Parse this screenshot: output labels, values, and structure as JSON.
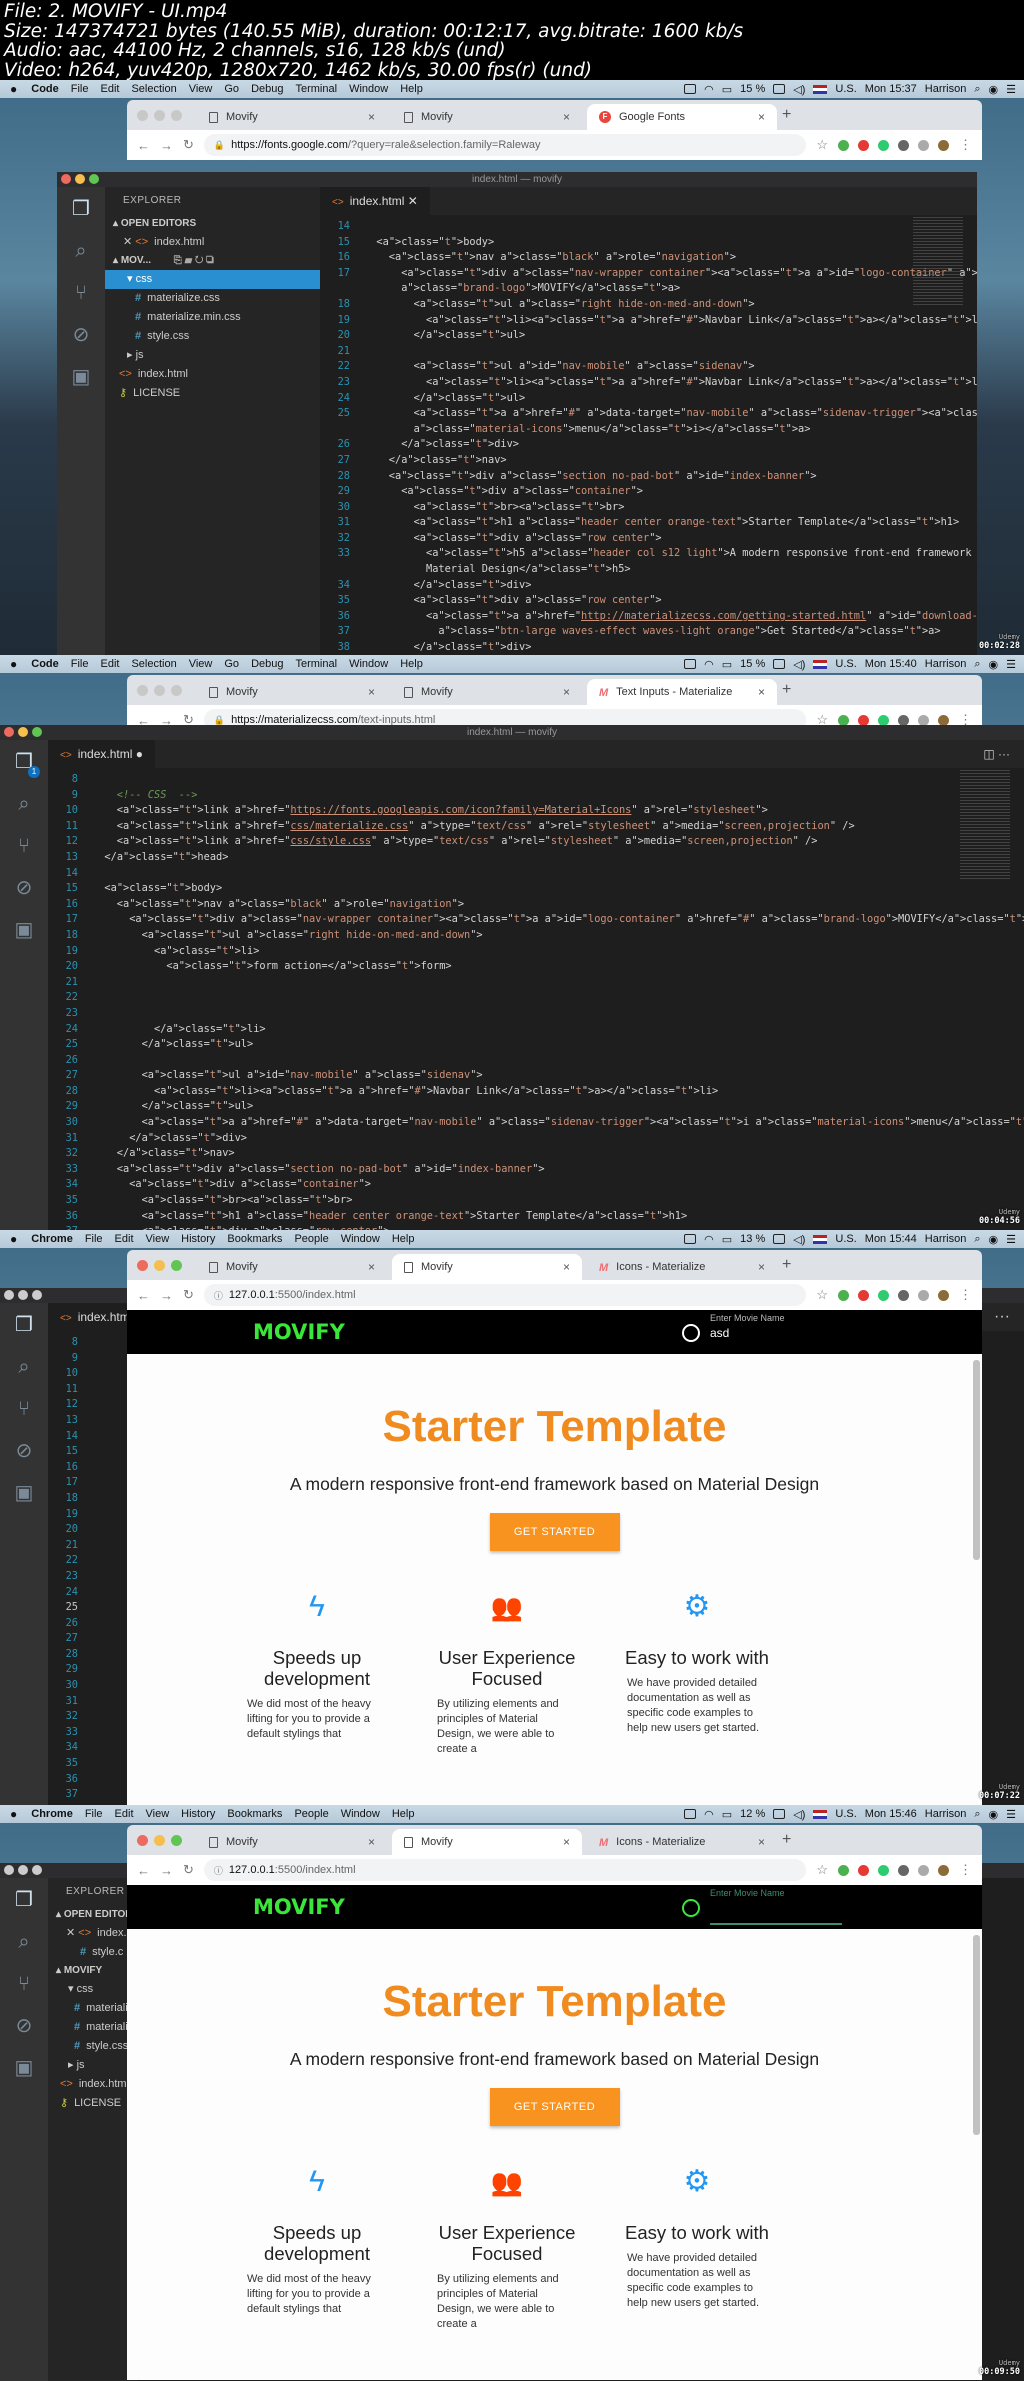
{
  "video_info": {
    "lines": [
      "File: 2. MOVIFY - UI.mp4",
      "Size: 147374721 bytes (140.55 MiB), duration: 00:12:17, avg.bitrate: 1600 kb/s",
      "Audio: aac, 44100 Hz, 2 channels, s16, 128 kb/s (und)",
      "Video: h264, yuv420p, 1280x720, 1462 kb/s, 30.00 fps(r) (und)"
    ]
  },
  "colors": {
    "orange": "#ef8b1f",
    "button_orange": "#f7931e",
    "logo_green": "#39e639",
    "icon_blue": "#2196f3",
    "input_line_teal": "#3d8c6e"
  },
  "frames": [
    {
      "timestamp": "00:02:28",
      "watermark": "Udemy",
      "menubar": {
        "app": "Code",
        "items": [
          "File",
          "Edit",
          "Selection",
          "View",
          "Go",
          "Debug",
          "Terminal",
          "Window",
          "Help"
        ],
        "battery": "15 %",
        "input": "U.S.",
        "clock": "Mon 15:37",
        "user": "Harrison"
      },
      "browser": {
        "tabs": [
          {
            "title": "Movify",
            "icon": "page-icon",
            "active": false
          },
          {
            "title": "Movify",
            "icon": "page-icon",
            "active": false
          },
          {
            "title": "Google Fonts",
            "icon": "google-fonts-icon",
            "active": true
          }
        ],
        "url_host": "https://fonts.google.com",
        "url_rest": "/?query=rale&selection.family=Raleway"
      },
      "vscode": {
        "title": "index.html — movify",
        "explorer": {
          "header": "EXPLORER",
          "open_editors": "OPEN EDITORS",
          "open_files": [
            "index.html"
          ],
          "project": "MOV...",
          "tree": [
            {
              "name": "css",
              "type": "folder-open",
              "selected": true
            },
            {
              "name": "materialize.css",
              "type": "css"
            },
            {
              "name": "materialize.min.css",
              "type": "css"
            },
            {
              "name": "style.css",
              "type": "css"
            },
            {
              "name": "js",
              "type": "folder"
            },
            {
              "name": "index.html",
              "type": "html"
            },
            {
              "name": "LICENSE",
              "type": "license"
            }
          ]
        },
        "tab": "index.html",
        "lines": [
          {
            "n": "14",
            "code": ""
          },
          {
            "n": "15",
            "code": "  <body>"
          },
          {
            "n": "16",
            "code": "    <nav class=\"black\" role=\"navigation\">"
          },
          {
            "n": "17",
            "code": "      <div class=\"nav-wrapper container\"><a id=\"logo-container\" href=\"#\""
          },
          {
            "n": "",
            "code": "      class=\"brand-logo\">MOVIFY</a>"
          },
          {
            "n": "18",
            "code": "        <ul class=\"right hide-on-med-and-down\">"
          },
          {
            "n": "19",
            "code": "          <li><a href=\"#\">Navbar Link</a></li>"
          },
          {
            "n": "20",
            "code": "        </ul>"
          },
          {
            "n": "21",
            "code": ""
          },
          {
            "n": "22",
            "code": "        <ul id=\"nav-mobile\" class=\"sidenav\">"
          },
          {
            "n": "23",
            "code": "          <li><a href=\"#\">Navbar Link</a></li>"
          },
          {
            "n": "24",
            "code": "        </ul>"
          },
          {
            "n": "25",
            "code": "        <a href=\"#\" data-target=\"nav-mobile\" class=\"sidenav-trigger\"><i"
          },
          {
            "n": "",
            "code": "        class=\"material-icons\">menu</i></a>"
          },
          {
            "n": "26",
            "code": "      </div>"
          },
          {
            "n": "27",
            "code": "    </nav>"
          },
          {
            "n": "28",
            "code": "    <div class=\"section no-pad-bot\" id=\"index-banner\">"
          },
          {
            "n": "29",
            "code": "      <div class=\"container\">"
          },
          {
            "n": "30",
            "code": "        <br><br>"
          },
          {
            "n": "31",
            "code": "        <h1 class=\"header center orange-text\">Starter Template</h1>"
          },
          {
            "n": "32",
            "code": "        <div class=\"row center\">"
          },
          {
            "n": "33",
            "code": "          <h5 class=\"header col s12 light\">A modern responsive front-end framework based on"
          },
          {
            "n": "",
            "code": "          Material Design</h5>"
          },
          {
            "n": "34",
            "code": "        </div>"
          },
          {
            "n": "35",
            "code": "        <div class=\"row center\">"
          },
          {
            "n": "36",
            "code": "          <a href=\"http://materializecss.com/getting-started.html\" id=\"download-button\""
          },
          {
            "n": "37",
            "code": "            class=\"btn-large waves-effect waves-light orange\">Get Started</a>"
          },
          {
            "n": "38",
            "code": "        </div>"
          }
        ]
      }
    },
    {
      "timestamp": "00:04:56",
      "watermark": "Udemy",
      "menubar": {
        "app": "Code",
        "items": [
          "File",
          "Edit",
          "Selection",
          "View",
          "Go",
          "Debug",
          "Terminal",
          "Window",
          "Help"
        ],
        "battery": "15 %",
        "input": "U.S.",
        "clock": "Mon 15:40",
        "user": "Harrison"
      },
      "browser": {
        "tabs": [
          {
            "title": "Movify",
            "icon": "page-icon",
            "active": false
          },
          {
            "title": "Movify",
            "icon": "page-icon",
            "active": false
          },
          {
            "title": "Text Inputs - Materialize",
            "icon": "materialize-icon",
            "active": true
          }
        ],
        "url_host": "https://materializecss.com",
        "url_rest": "/text-inputs.html"
      },
      "vscode": {
        "title": "index.html — movify",
        "tab": "index.html",
        "tab_modified": true,
        "badge": "1",
        "lines": [
          {
            "n": "8",
            "code": ""
          },
          {
            "n": "9",
            "code": "    <!-- CSS  -->"
          },
          {
            "n": "10",
            "code": "    <link href=\"https://fonts.googleapis.com/icon?family=Material+Icons\" rel=\"stylesheet\">"
          },
          {
            "n": "11",
            "code": "    <link href=\"css/materialize.css\" type=\"text/css\" rel=\"stylesheet\" media=\"screen,projection\" />"
          },
          {
            "n": "12",
            "code": "    <link href=\"css/style.css\" type=\"text/css\" rel=\"stylesheet\" media=\"screen,projection\" />"
          },
          {
            "n": "13",
            "code": "  </head>"
          },
          {
            "n": "14",
            "code": ""
          },
          {
            "n": "15",
            "code": "  <body>"
          },
          {
            "n": "16",
            "code": "    <nav class=\"black\" role=\"navigation\">"
          },
          {
            "n": "17",
            "code": "      <div class=\"nav-wrapper container\"><a id=\"logo-container\" href=\"#\" class=\"brand-logo\">MOVIFY</a>"
          },
          {
            "n": "18",
            "code": "        <ul class=\"right hide-on-med-and-down\">"
          },
          {
            "n": "19",
            "code": "          <li>"
          },
          {
            "n": "20",
            "code": "            <form action=</form>"
          },
          {
            "n": "21",
            "code": ""
          },
          {
            "n": "22",
            "code": ""
          },
          {
            "n": "23",
            "code": ""
          },
          {
            "n": "24",
            "code": "          </li>"
          },
          {
            "n": "25",
            "code": "        </ul>"
          },
          {
            "n": "26",
            "code": ""
          },
          {
            "n": "27",
            "code": "        <ul id=\"nav-mobile\" class=\"sidenav\">"
          },
          {
            "n": "28",
            "code": "          <li><a href=\"#\">Navbar Link</a></li>"
          },
          {
            "n": "29",
            "code": "        </ul>"
          },
          {
            "n": "30",
            "code": "        <a href=\"#\" data-target=\"nav-mobile\" class=\"sidenav-trigger\"><i class=\"material-icons\">menu</i></a>"
          },
          {
            "n": "31",
            "code": "      </div>"
          },
          {
            "n": "32",
            "code": "    </nav>"
          },
          {
            "n": "33",
            "code": "    <div class=\"section no-pad-bot\" id=\"index-banner\">"
          },
          {
            "n": "34",
            "code": "      <div class=\"container\">"
          },
          {
            "n": "35",
            "code": "        <br><br>"
          },
          {
            "n": "36",
            "code": "        <h1 class=\"header center orange-text\">Starter Template</h1>"
          },
          {
            "n": "37",
            "code": "        <div class=\"row center\">"
          }
        ]
      }
    },
    {
      "timestamp": "00:07:22",
      "watermark": "Udemy",
      "menubar": {
        "app": "Chrome",
        "items": [
          "File",
          "Edit",
          "View",
          "History",
          "Bookmarks",
          "People",
          "Window",
          "Help"
        ],
        "battery": "13 %",
        "input": "U.S.",
        "clock": "Mon 15:44",
        "user": "Harrison"
      },
      "browser": {
        "tabs": [
          {
            "title": "Movify",
            "icon": "page-icon",
            "active": false
          },
          {
            "title": "Movify",
            "icon": "page-icon",
            "active": true
          },
          {
            "title": "Icons - Materialize",
            "icon": "materialize-icon",
            "active": false
          }
        ],
        "url_host": "127.0.0.1",
        "url_rest": ":5500/index.html"
      },
      "vscode_bg": {
        "tab": "index.htm",
        "line_numbers": [
          "8",
          "9",
          "10",
          "11",
          "12",
          "13",
          "14",
          "15",
          "16",
          "17",
          "18",
          "19",
          "20",
          "21",
          "22",
          "23",
          "24",
          "25",
          "26",
          "27",
          "28",
          "29",
          "30",
          "31",
          "32",
          "33",
          "34",
          "35",
          "36",
          "37"
        ],
        "current_line": "25"
      },
      "page": {
        "logo": "MOVIFY",
        "search_label": "Enter Movie Name",
        "search_value": "asd",
        "title": "Starter Template",
        "subtitle": "A modern responsive front-end framework based on Material Design",
        "button": "GET STARTED",
        "features": [
          {
            "icon": "flash-icon",
            "title": "Speeds up development",
            "text": "We did most of the heavy lifting for you to provide a default stylings that"
          },
          {
            "icon": "group-icon",
            "title": "User Experience Focused",
            "text": "By utilizing elements and principles of Material Design, we were able to create a"
          },
          {
            "icon": "settings-icon",
            "title": "Easy to work with",
            "text": "We have provided detailed documentation as well as specific code examples to help new users get started."
          }
        ]
      }
    },
    {
      "timestamp": "00:09:50",
      "watermark": "Udemy",
      "menubar": {
        "app": "Chrome",
        "items": [
          "File",
          "Edit",
          "View",
          "History",
          "Bookmarks",
          "People",
          "Window",
          "Help"
        ],
        "battery": "12 %",
        "input": "U.S.",
        "clock": "Mon 15:46",
        "user": "Harrison"
      },
      "browser": {
        "tabs": [
          {
            "title": "Movify",
            "icon": "page-icon",
            "active": false
          },
          {
            "title": "Movify",
            "icon": "page-icon",
            "active": true
          },
          {
            "title": "Icons - Materialize",
            "icon": "materialize-icon",
            "active": false
          }
        ],
        "url_host": "127.0.0.1",
        "url_rest": ":5500/index.html"
      },
      "vscode_bg": {
        "explorer_header": "EXPLORER",
        "open_editors": "OPEN EDITOR",
        "open_files": [
          "index.",
          "style.c"
        ],
        "project": "MOVIFY",
        "tree": [
          "css",
          "materiali",
          "materiali",
          "style.css",
          "js",
          "index.htm",
          "LICENSE"
        ]
      },
      "page": {
        "logo": "MOVIFY",
        "search_label": "Enter Movie Name",
        "search_value": "",
        "title": "Starter Template",
        "subtitle": "A modern responsive front-end framework based on Material Design",
        "button": "GET STARTED",
        "features": [
          {
            "icon": "flash-icon",
            "title": "Speeds up development",
            "text": "We did most of the heavy lifting for you to provide a default stylings that"
          },
          {
            "icon": "group-icon",
            "title": "User Experience Focused",
            "text": "By utilizing elements and principles of Material Design, we were able to create a"
          },
          {
            "icon": "settings-icon",
            "title": "Easy to work with",
            "text": "We have provided detailed documentation as well as specific code examples to help new users get started."
          }
        ]
      }
    }
  ]
}
